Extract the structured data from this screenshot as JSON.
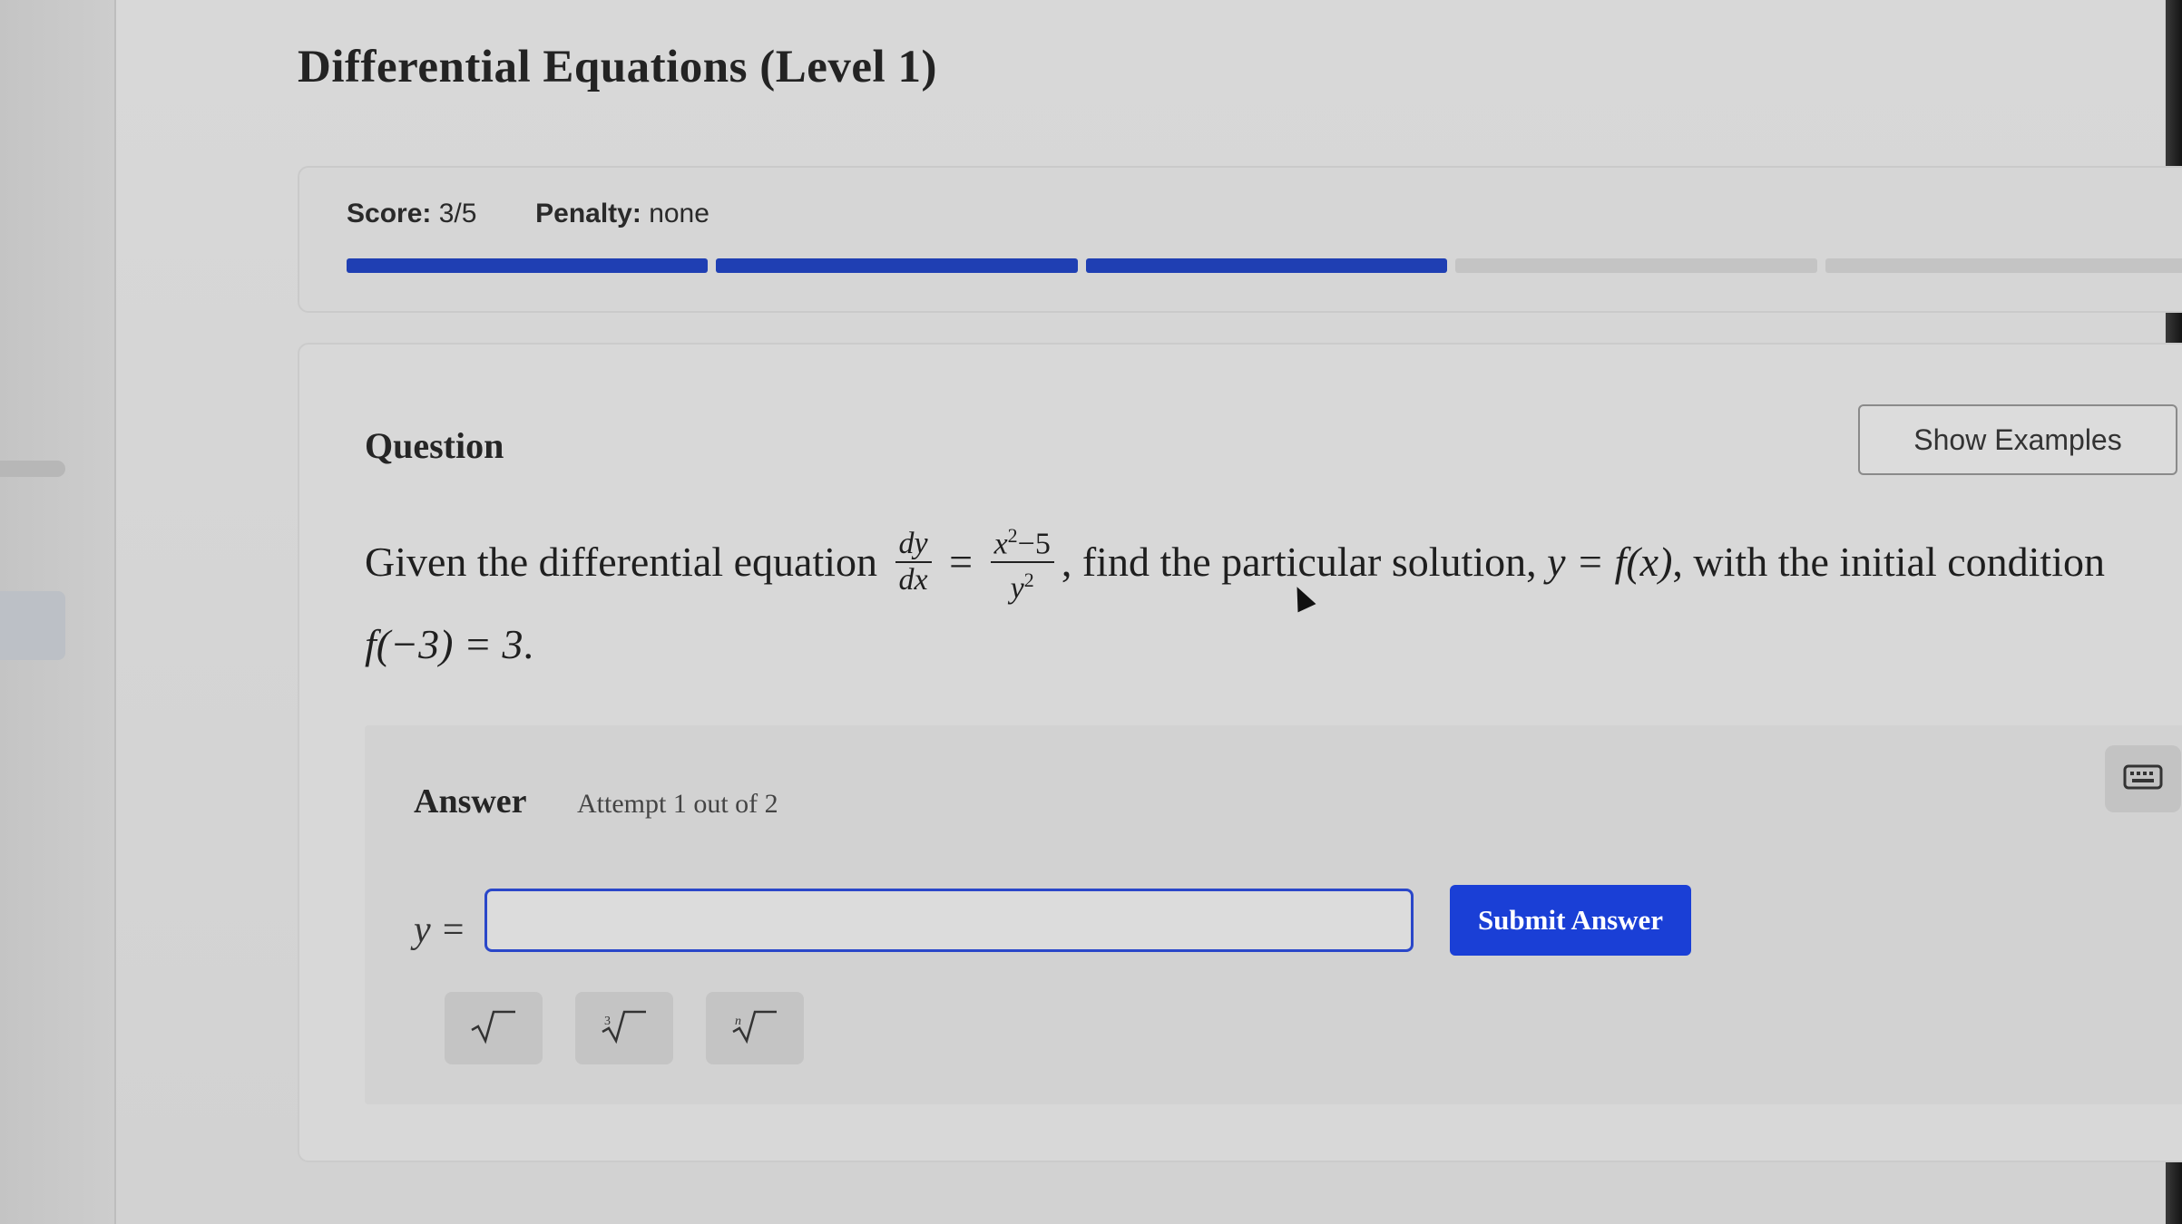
{
  "page": {
    "title": "Differential Equations (Level 1)"
  },
  "score": {
    "score_label": "Score:",
    "score_value": "3/5",
    "penalty_label": "Penalty:",
    "penalty_value": "none",
    "segments_total": 5,
    "segments_completed": 3,
    "progress_color": "#1f3fb3"
  },
  "question": {
    "heading": "Question",
    "show_examples_label": "Show Examples",
    "text_intro": "Given the differential equation",
    "dydx_num": "dy",
    "dydx_den": "dx",
    "equals": "=",
    "rhs_num_base": "x",
    "rhs_num_exp": "2",
    "rhs_num_rest": "−5",
    "rhs_den_base": "y",
    "rhs_den_exp": "2",
    "text_mid": ", find the particular solution,",
    "solution_form": "y = f(x)",
    "text_cond": ", with the initial condition",
    "initial_condition": "f(−3) = 3",
    "text_end": "."
  },
  "answer": {
    "title": "Answer",
    "attempt_text": "Attempt 1 out of 2",
    "input_prefix": "y =",
    "input_value": "",
    "submit_label": "Submit Answer",
    "submit_color": "#1a3fd6"
  },
  "tools": [
    {
      "name": "square-root-icon",
      "index": ""
    },
    {
      "name": "cube-root-icon",
      "index": "3"
    },
    {
      "name": "nth-root-icon",
      "index": "n"
    }
  ],
  "icons": {
    "keyboard": "keyboard-icon"
  }
}
